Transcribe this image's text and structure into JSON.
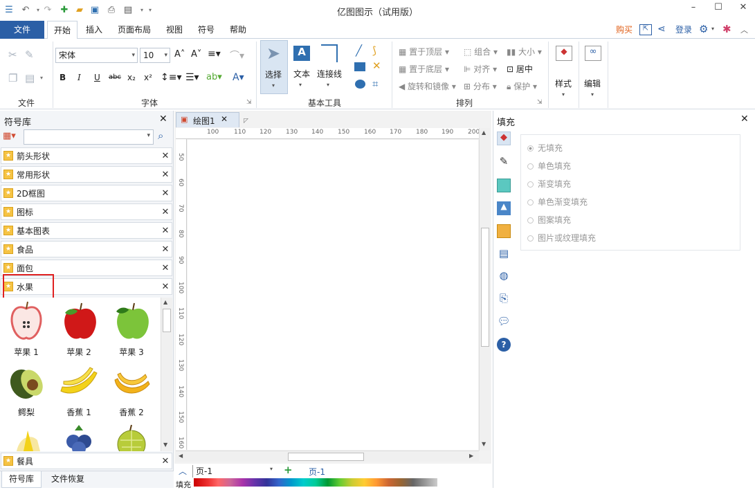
{
  "app": {
    "title": "亿图图示（试用版）"
  },
  "menu": {
    "file": "文件",
    "tabs": [
      "开始",
      "插入",
      "页面布局",
      "视图",
      "符号",
      "帮助"
    ]
  },
  "topright": {
    "buy": "购买",
    "login": "登录"
  },
  "ribbon": {
    "file_group": "文件",
    "font_group": "字体",
    "font_name": "宋体",
    "font_size": "10",
    "basic_tools": "基本工具",
    "select": "选择",
    "text": "文本",
    "connector": "连接线",
    "arrange": "排列",
    "to_top": "置于顶层",
    "to_bottom": "置于底层",
    "rotate": "旋转和镜像",
    "group": "组合",
    "align": "对齐",
    "distribute": "分布",
    "size": "大小",
    "center": "居中",
    "protect": "保护",
    "style": "样式",
    "edit": "编辑"
  },
  "left": {
    "title": "符号库",
    "libraries": [
      "箭头形状",
      "常用形状",
      "2D框图",
      "图标",
      "基本图表",
      "食品",
      "面包",
      "水果"
    ],
    "shapes": [
      "苹果 1",
      "苹果 2",
      "苹果 3",
      "鳄梨",
      "香蕉 1",
      "香蕉 2"
    ],
    "bottom_lib": "餐具",
    "tabs": [
      "符号库",
      "文件恢复"
    ]
  },
  "canvas": {
    "doc_tab": "绘图1",
    "hruler": [
      "100",
      "110",
      "120",
      "130",
      "140",
      "150",
      "160",
      "170",
      "180",
      "190",
      "200"
    ],
    "vruler": [
      "50",
      "60",
      "70",
      "80",
      "90",
      "100",
      "110",
      "120",
      "130",
      "140",
      "150",
      "160"
    ]
  },
  "right": {
    "title": "填充",
    "options": [
      "无填充",
      "单色填充",
      "渐变填充",
      "单色渐变填充",
      "图案填充",
      "图片或纹理填充"
    ]
  },
  "bottom": {
    "page_select": "页-1",
    "page_tab": "页-1",
    "fill_label": "填充"
  },
  "colors": {
    "accent": "#2b5fa6",
    "highlight": "#e02020"
  }
}
